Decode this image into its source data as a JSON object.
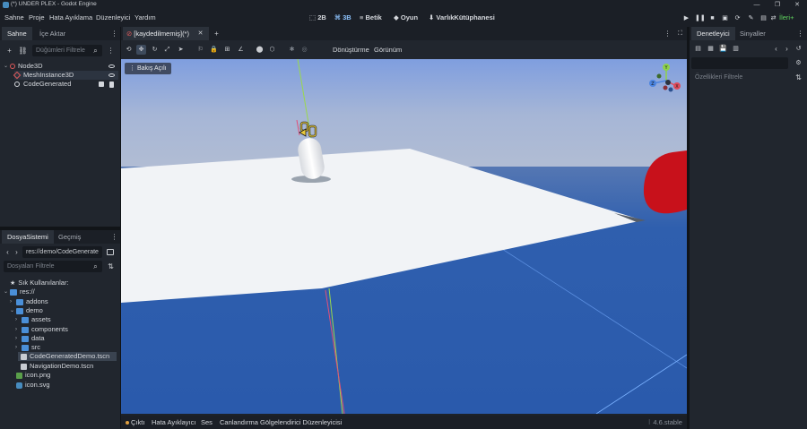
{
  "window": {
    "title": "(*) UNDER PLEX - Godot Engine",
    "controls": [
      "—",
      "❐",
      "✕"
    ]
  },
  "menus": [
    "Sahne",
    "Proje",
    "Hata Ayıklama",
    "Düzenleyici",
    "Yardım"
  ],
  "modes": [
    {
      "icon": "⬚",
      "label": "2B"
    },
    {
      "icon": "⌘",
      "label": "3B"
    },
    {
      "icon": "≡",
      "label": "Betik"
    },
    {
      "icon": "◆",
      "label": "Oyun"
    },
    {
      "icon": "⬇",
      "label": "VarlıkKütüphanesi"
    }
  ],
  "run_controls": [
    "▶",
    "❚❚",
    "■",
    "▣",
    "⟳",
    "✎",
    "▤",
    "⇄"
  ],
  "renderer": "İleri+",
  "scene_dock": {
    "tabs": [
      "Sahne",
      "İçe Aktar"
    ],
    "add_icon": "+",
    "link_icon": "⛓",
    "filter_placeholder": "Düğümleri Filtrele",
    "search_icon": "⌕",
    "menu_icon": "⋮",
    "nodes": [
      {
        "name": "Node3D",
        "arrow": "⌄"
      },
      {
        "name": "MeshInstance3D"
      },
      {
        "name": "CodeGenerated"
      }
    ]
  },
  "filesystem_dock": {
    "tabs": [
      "DosyaSistemi",
      "Geçmiş"
    ],
    "menu_icon": "⋮",
    "nav_back": "‹",
    "nav_forward": "›",
    "path": "res://demo/CodeGenerate",
    "filter_placeholder": "Dosyaları Filtrele",
    "search_icon": "⌕",
    "sort_icon": "⇅",
    "favorites": "Sık Kullanılanlar:",
    "star": "★",
    "items": [
      {
        "label": "res://",
        "arrow": "⌄"
      },
      {
        "label": "addons",
        "arrow": "›"
      },
      {
        "label": "demo",
        "arrow": "⌄"
      },
      {
        "label": "assets",
        "arrow": "›"
      },
      {
        "label": "components",
        "arrow": "›"
      },
      {
        "label": "data",
        "arrow": "›"
      },
      {
        "label": "src",
        "arrow": "›"
      },
      {
        "label": "CodeGeneratedDemo.tscn"
      },
      {
        "label": "NavigationDemo.tscn"
      },
      {
        "label": "icon.png"
      },
      {
        "label": "icon.svg"
      }
    ]
  },
  "editor": {
    "tab": "[kaydedilmemiş](*)",
    "tab_icon": "⊘",
    "tab_close": "✕",
    "add_tab": "+",
    "more_icon": "⋮",
    "fullscreen_icon": "⛶",
    "toolbar_icons": [
      "⟲",
      "✥",
      "↻",
      "⤢",
      "➤",
      "⚐",
      "🔒",
      "⊞",
      "∠",
      "⬤",
      "⬡",
      "✱",
      "◎"
    ],
    "transform_menu": "Dönüştürme",
    "view_menu": "Görünüm",
    "perspective": "⋮ Bakış Açılı",
    "gizmo": {
      "x": "X",
      "y": "Y",
      "z": "Z"
    }
  },
  "inspector_dock": {
    "tabs": [
      "Denetleyici",
      "Sinyaller"
    ],
    "menu_icon": "⋮",
    "tool_icons": [
      "▤",
      "▦",
      "💾",
      "▥"
    ],
    "nav_back": "‹",
    "nav_forward": "›",
    "history_icon": "↺",
    "tune_icon": "⚙",
    "filter_placeholder": "Özellikleri Filtrele",
    "sort_icon": "⇅"
  },
  "bottom_panel": {
    "tabs": [
      "Çıktı",
      "Hata Ayıklayıcı",
      "Ses",
      "Canlandırma",
      "Gölgelendirici Düzenleyicisi"
    ],
    "version": "4.6.stable"
  },
  "colors": {
    "accent": "#478cbf",
    "active_mode": "#8ec4ff",
    "renderer_green": "#5fd35f",
    "sky_top": "#7f9edf",
    "sky_horizon": "#b5bfd3",
    "ground": "#2f5fae",
    "plane": "#f1f3f6",
    "red_object": "#c8111b"
  }
}
